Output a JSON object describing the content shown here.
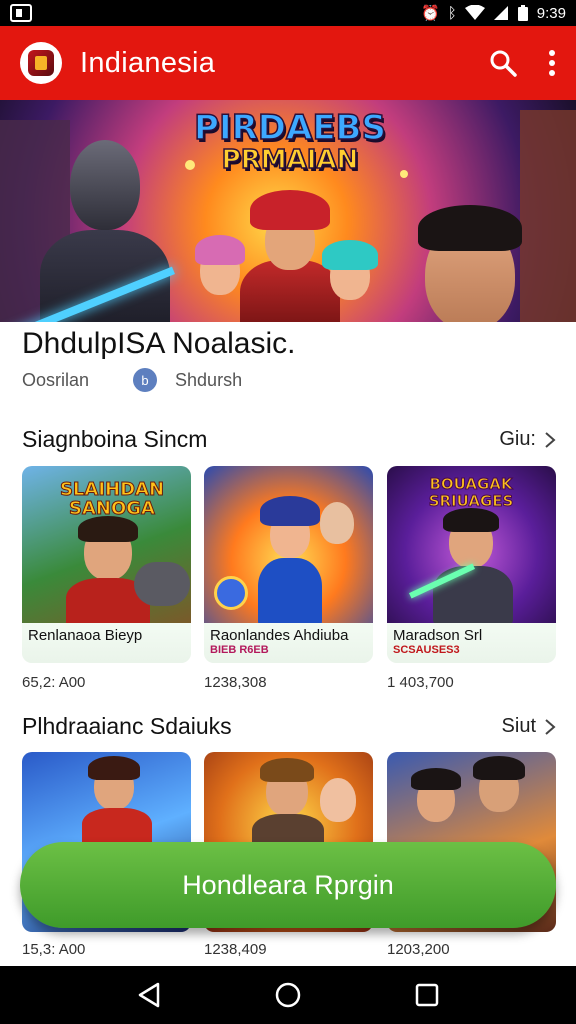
{
  "app_bar": {
    "title": "Indianesia",
    "logo_icon": "app-logo-icon",
    "accent": "#e3170f"
  },
  "status_bar": {
    "time": "9:39"
  },
  "hero": {
    "title_line1": "PIRDAEBS",
    "title_line2": "PRMAIAN"
  },
  "headline": "DhdulpISA Noalasic.",
  "meta": {
    "source": "Oosrilan",
    "author_initial": "b",
    "author": "Shdursh"
  },
  "section1": {
    "title": "Siagnboina Sincm",
    "more": "Giu:",
    "cards": [
      {
        "name": "Renlanaoa Bieyp",
        "sub": "",
        "price": "65,2: A00",
        "art_title": "SLAIHDAN SANOGA"
      },
      {
        "name": "Raonlandes Ahdiuba",
        "sub": "BIEB R6EB",
        "price": "1238,308",
        "art_title": ""
      },
      {
        "name": "Maradson Srl",
        "sub": "SCSAUSES3",
        "price": "1 403,700",
        "art_title": "BOUAGAK SRIUAGES"
      }
    ]
  },
  "section2": {
    "title": "Plhdraaianc Sdaiuks",
    "more": "Siut",
    "cards": [
      {
        "price": "15,3: A00"
      },
      {
        "price": "1238,409"
      },
      {
        "price": "1203,200"
      }
    ]
  },
  "cta": {
    "label": "Hondleara Rprgin",
    "color": "#4caf36"
  }
}
